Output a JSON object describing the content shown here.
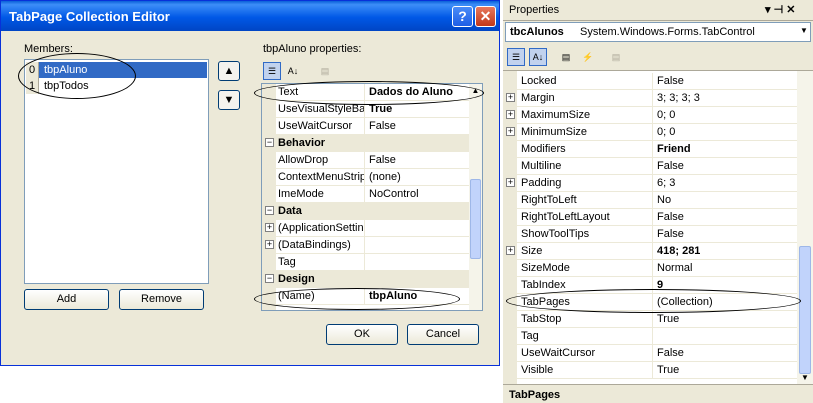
{
  "dialog": {
    "title": "TabPage Collection Editor",
    "help_glyph": "?",
    "close_glyph": "✕",
    "members_label": "Members:",
    "members": [
      {
        "index": "0",
        "name": "tbpAluno",
        "selected": true
      },
      {
        "index": "1",
        "name": "tbpTodos",
        "selected": false
      }
    ],
    "up_glyph": "▲",
    "down_glyph": "▼",
    "add_label": "Add",
    "remove_label": "Remove",
    "props_label": "tbpAluno properties:",
    "grid_rows": [
      {
        "kind": "prop",
        "name": "Text",
        "value": "Dados do Aluno",
        "bold": true
      },
      {
        "kind": "prop",
        "name": "UseVisualStyleBac",
        "value": "True",
        "bold": true
      },
      {
        "kind": "prop",
        "name": "UseWaitCursor",
        "value": "False",
        "bold": false
      },
      {
        "kind": "cat",
        "name": "Behavior"
      },
      {
        "kind": "prop",
        "name": "AllowDrop",
        "value": "False",
        "bold": false
      },
      {
        "kind": "prop",
        "name": "ContextMenuStrip",
        "value": "(none)",
        "bold": false
      },
      {
        "kind": "prop",
        "name": "ImeMode",
        "value": "NoControl",
        "bold": false
      },
      {
        "kind": "cat",
        "name": "Data"
      },
      {
        "kind": "prop",
        "name": "(ApplicationSettin",
        "value": "",
        "bold": false,
        "expandable": true
      },
      {
        "kind": "prop",
        "name": "(DataBindings)",
        "value": "",
        "bold": false,
        "expandable": true
      },
      {
        "kind": "prop",
        "name": "Tag",
        "value": "",
        "bold": false
      },
      {
        "kind": "cat",
        "name": "Design"
      },
      {
        "kind": "prop",
        "name": "(Name)",
        "value": "tbpAluno",
        "bold": true
      }
    ],
    "ok_label": "OK",
    "cancel_label": "Cancel"
  },
  "properties": {
    "title": "Properties",
    "pin_glyph": "▾ ⊣ ✕",
    "object_name": "tbcAlunos",
    "object_type": "System.Windows.Forms.TabControl",
    "rows": [
      {
        "name": "Locked",
        "value": "False",
        "bold": false
      },
      {
        "name": "Margin",
        "value": "3; 3; 3; 3",
        "bold": false,
        "expandable": true
      },
      {
        "name": "MaximumSize",
        "value": "0; 0",
        "bold": false,
        "expandable": true
      },
      {
        "name": "MinimumSize",
        "value": "0; 0",
        "bold": false,
        "expandable": true
      },
      {
        "name": "Modifiers",
        "value": "Friend",
        "bold": true
      },
      {
        "name": "Multiline",
        "value": "False",
        "bold": false
      },
      {
        "name": "Padding",
        "value": "6; 3",
        "bold": false,
        "expandable": true
      },
      {
        "name": "RightToLeft",
        "value": "No",
        "bold": false
      },
      {
        "name": "RightToLeftLayout",
        "value": "False",
        "bold": false
      },
      {
        "name": "ShowToolTips",
        "value": "False",
        "bold": false
      },
      {
        "name": "Size",
        "value": "418; 281",
        "bold": true,
        "expandable": true
      },
      {
        "name": "SizeMode",
        "value": "Normal",
        "bold": false
      },
      {
        "name": "TabIndex",
        "value": "9",
        "bold": true
      },
      {
        "name": "TabPages",
        "value": "(Collection)",
        "bold": false
      },
      {
        "name": "TabStop",
        "value": "True",
        "bold": false
      },
      {
        "name": "Tag",
        "value": "",
        "bold": false
      },
      {
        "name": "UseWaitCursor",
        "value": "False",
        "bold": false
      },
      {
        "name": "Visible",
        "value": "True",
        "bold": false
      }
    ],
    "description_title": "TabPages"
  }
}
